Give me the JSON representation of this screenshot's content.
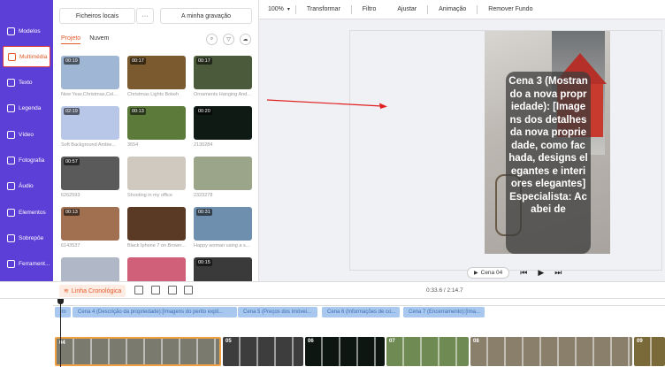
{
  "sidebar": {
    "items": [
      {
        "label": "Modelos",
        "icon": "grid-icon"
      },
      {
        "label": "Multimédia",
        "icon": "media-icon",
        "active": true
      },
      {
        "label": "Texto",
        "icon": "text-icon"
      },
      {
        "label": "Legenda",
        "icon": "subtitle-icon"
      },
      {
        "label": "Vídeo",
        "icon": "video-icon"
      },
      {
        "label": "Fotografia",
        "icon": "photo-icon"
      },
      {
        "label": "Áudio",
        "icon": "audio-icon"
      },
      {
        "label": "Elementos",
        "icon": "elements-icon"
      },
      {
        "label": "Sobrepôe",
        "icon": "overlay-icon"
      },
      {
        "label": "Ferrament...",
        "icon": "tools-icon"
      }
    ]
  },
  "panel": {
    "local_files": "Ficheiros locais",
    "more": "···",
    "my_recording": "A minha gravação",
    "tabs": [
      "Projeto",
      "Nuvem"
    ],
    "items": [
      {
        "duration": "00:19",
        "caption": "New Year,Christmas,Cel...",
        "color": "#9fb7d4"
      },
      {
        "duration": "00:17",
        "caption": "Christmas Lights Bokeh",
        "color": "#7a5a2e"
      },
      {
        "duration": "00:17",
        "caption": "Ornaments Hanging And...",
        "color": "#4b5a3a"
      },
      {
        "duration": "02:19",
        "caption": "Soft Background Ambie...",
        "color": "#b8c6e8"
      },
      {
        "duration": "00:13",
        "caption": "3654",
        "color": "#5c7a3a"
      },
      {
        "duration": "00:20",
        "caption": "2130284",
        "color": "#0f1a14"
      },
      {
        "duration": "00:57",
        "caption": "6262593",
        "color": "#5a5a5a"
      },
      {
        "duration": "",
        "caption": "Shooting in my office",
        "color": "#cfc9c0"
      },
      {
        "duration": "",
        "caption": "2323278",
        "color": "#9aa58a"
      },
      {
        "duration": "00:13",
        "caption": "6143537",
        "color": "#a07050"
      },
      {
        "duration": "",
        "caption": "Black Iphone 7 on Brown...",
        "color": "#5a3a24"
      },
      {
        "duration": "00:31",
        "caption": "Happy woman using a s...",
        "color": "#6f8fae"
      },
      {
        "duration": "",
        "caption": "",
        "color": "#b0b8c8"
      },
      {
        "duration": "",
        "caption": "",
        "color": "#d0607a"
      },
      {
        "duration": "00:15",
        "caption": "",
        "color": "#3a3a3a"
      }
    ]
  },
  "topbar": {
    "zoom": "100%",
    "items": [
      "Transformar",
      "Filtro",
      "Ajustar",
      "Animação",
      "Remover Fundo"
    ]
  },
  "preview": {
    "caption": "Cena 3 (Mostrando a nova propriedade): [Imagens dos detalhes da nova propriedade, como fachada, designs elegantes e interiores elegantes]Especialista: Acabei de",
    "scene_label": "Cena 04"
  },
  "timeline": {
    "label": "Linha Cronológica",
    "time": "0:33.6 / 2:14.7",
    "text_clips": [
      {
        "label": "Im"
      },
      {
        "label": "Cena 4 (Descrição da propriedade):[Imagens do perito expli..."
      },
      {
        "label": "Cena 5 (Preços dos imóvei..."
      },
      {
        "label": "Cena 6 (Informações de co..."
      },
      {
        "label": "Cena 7 (Encerramento):[Ima..."
      }
    ],
    "video_clips": [
      {
        "label": "04",
        "color": "#7a7a6e",
        "selected": true
      },
      {
        "label": "05",
        "color": "#3d3d3d"
      },
      {
        "label": "06",
        "color": "#0e1612"
      },
      {
        "label": "07",
        "color": "#6f8a52"
      },
      {
        "label": "08",
        "color": "#8a7f6a"
      },
      {
        "label": "09",
        "color": "#7a6a3a"
      }
    ]
  }
}
